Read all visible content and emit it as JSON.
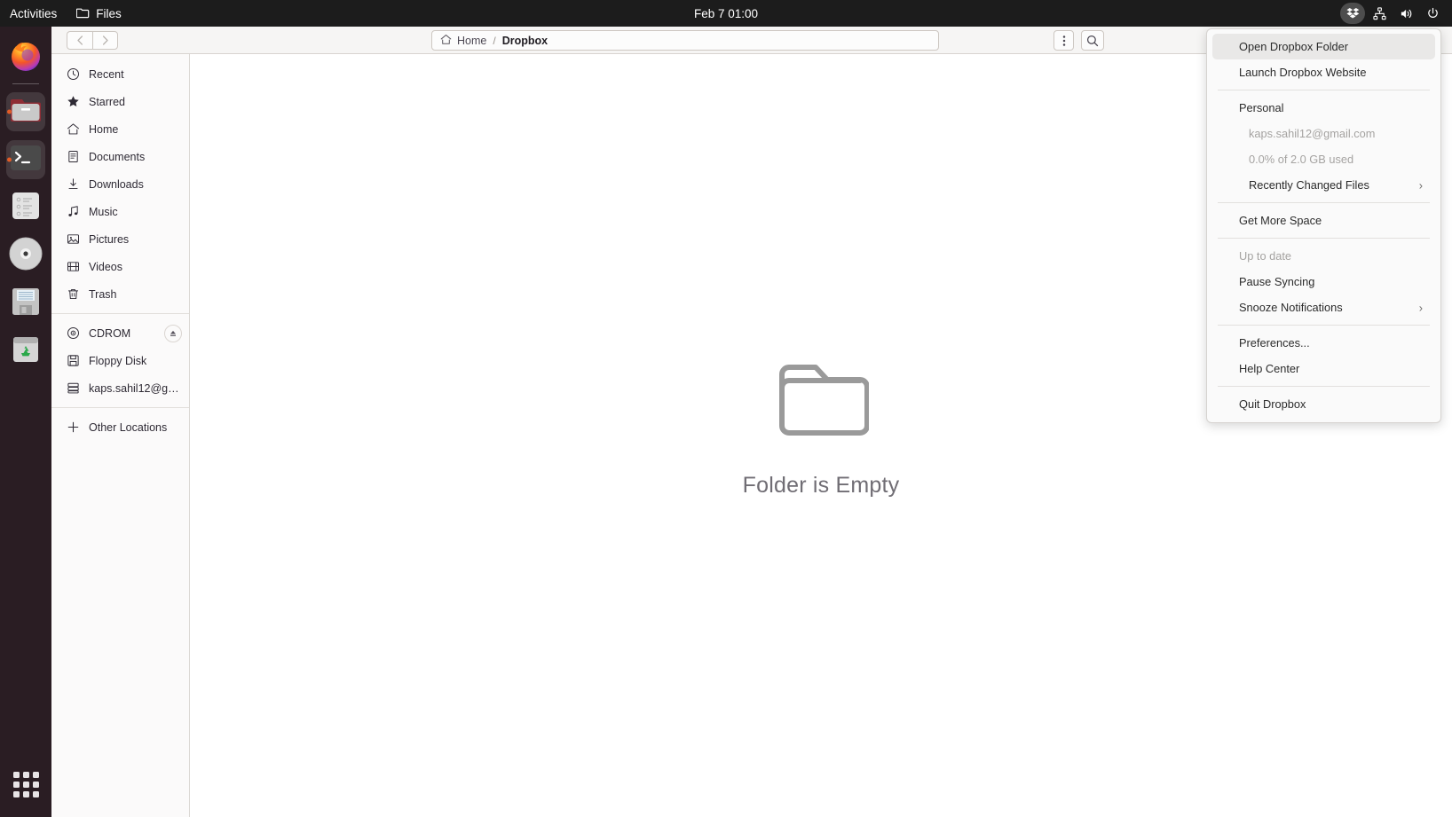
{
  "topbar": {
    "activities_label": "Activities",
    "app_label": "Files",
    "app_icon": "folder-icon",
    "clock": "Feb 7  01:00",
    "indicators": [
      {
        "name": "dropbox-indicator-icon",
        "active": true
      },
      {
        "name": "network-icon",
        "active": false
      },
      {
        "name": "volume-icon",
        "active": false
      },
      {
        "name": "power-icon",
        "active": false
      }
    ]
  },
  "dock": {
    "items": [
      {
        "name": "firefox",
        "running": false
      },
      {
        "name": "files",
        "running": true
      },
      {
        "name": "terminal",
        "running": true
      },
      {
        "name": "text-editor",
        "running": false
      },
      {
        "name": "cdrom",
        "running": false
      },
      {
        "name": "floppy-disk",
        "running": false
      },
      {
        "name": "trash",
        "running": false
      }
    ],
    "show_apps_label": "Show Applications"
  },
  "filemanager": {
    "nav": {
      "back": "Back",
      "forward": "Forward"
    },
    "path": {
      "home_label": "Home",
      "separator": "/",
      "current_label": "Dropbox"
    },
    "header_buttons": [
      {
        "name": "view-options-menu-button",
        "icon": "vertical-dots-icon"
      },
      {
        "name": "search-button",
        "icon": "search-icon"
      }
    ],
    "sidebar": [
      {
        "label": "Recent",
        "icon": "clock-icon",
        "group": 0
      },
      {
        "label": "Starred",
        "icon": "star-icon",
        "group": 0
      },
      {
        "label": "Home",
        "icon": "home-icon",
        "group": 0
      },
      {
        "label": "Documents",
        "icon": "document-icon",
        "group": 0
      },
      {
        "label": "Downloads",
        "icon": "download-icon",
        "group": 0
      },
      {
        "label": "Music",
        "icon": "music-note-icon",
        "group": 0
      },
      {
        "label": "Pictures",
        "icon": "image-icon",
        "group": 0
      },
      {
        "label": "Videos",
        "icon": "video-icon",
        "group": 0
      },
      {
        "label": "Trash",
        "icon": "trash-icon",
        "group": 0
      },
      {
        "label": "CDROM",
        "icon": "disc-icon",
        "group": 1,
        "eject": true
      },
      {
        "label": "Floppy Disk",
        "icon": "floppy-icon",
        "group": 1
      },
      {
        "label": "kaps.sahil12@gm…",
        "icon": "drive-icon",
        "group": 1
      },
      {
        "label": "Other Locations",
        "icon": "plus-icon",
        "group": 2
      }
    ],
    "main": {
      "empty_icon": "empty-folder-icon",
      "empty_text": "Folder is Empty"
    }
  },
  "dropbox_menu": {
    "items": [
      {
        "label": "Open Dropbox Folder",
        "type": "item",
        "state": "highlight"
      },
      {
        "label": "Launch Dropbox Website",
        "type": "item",
        "state": "normal"
      },
      {
        "type": "separator"
      },
      {
        "label": "Personal",
        "type": "item",
        "state": "normal"
      },
      {
        "label": "kaps.sahil12@gmail.com",
        "type": "item",
        "state": "dim",
        "indent": true
      },
      {
        "label": "0.0% of 2.0 GB used",
        "type": "item",
        "state": "dim",
        "indent": true
      },
      {
        "label": "Recently Changed Files",
        "type": "item",
        "state": "normal",
        "indent": true,
        "submenu": true
      },
      {
        "type": "separator"
      },
      {
        "label": "Get More Space",
        "type": "item",
        "state": "normal"
      },
      {
        "type": "separator"
      },
      {
        "label": "Up to date",
        "type": "item",
        "state": "dim"
      },
      {
        "label": "Pause Syncing",
        "type": "item",
        "state": "normal"
      },
      {
        "label": "Snooze Notifications",
        "type": "item",
        "state": "normal",
        "submenu": true
      },
      {
        "type": "separator"
      },
      {
        "label": "Preferences...",
        "type": "item",
        "state": "normal"
      },
      {
        "label": "Help Center",
        "type": "item",
        "state": "normal"
      },
      {
        "type": "separator"
      },
      {
        "label": "Quit Dropbox",
        "type": "item",
        "state": "normal"
      }
    ],
    "submenu_glyph": "›"
  },
  "colors": {
    "topbar_bg": "#1c1c1c",
    "dock_bg": "#231620",
    "header_bg": "#f6f5f4",
    "sidebar_bg": "#fbfafa",
    "menu_bg": "#fafafa",
    "accent_orange": "#e25b26",
    "empty_text": "#706d74"
  }
}
